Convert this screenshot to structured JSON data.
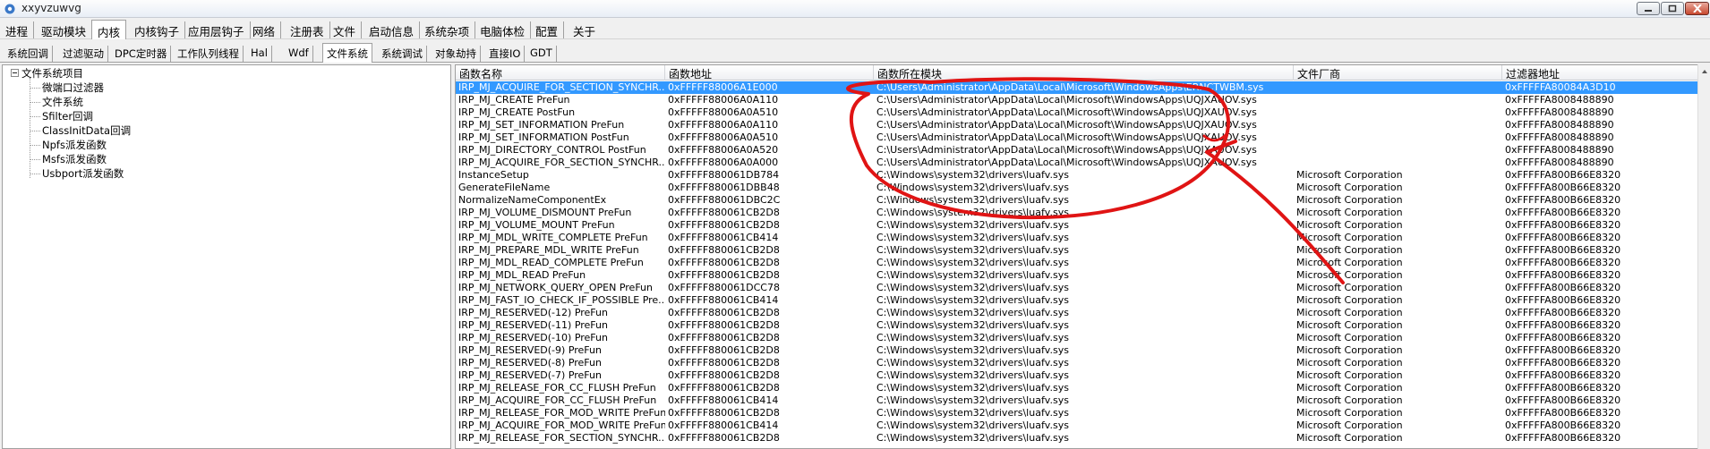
{
  "window": {
    "title": "xxyvzuwvg",
    "icon": "gear-app-icon",
    "controls": [
      "minimize-icon",
      "maximize-icon",
      "close-icon"
    ]
  },
  "menu": {
    "items": [
      "进程",
      "驱动模块",
      "内核",
      "内核钩子",
      "应用层钩子",
      "网络",
      "注册表",
      "文件",
      "启动信息",
      "系统杂项",
      "电脑体检",
      "配置",
      "关于"
    ],
    "active_index": 2
  },
  "subtabs": {
    "items": [
      "系统回调",
      "过滤驱动",
      "DPC定时器",
      "工作队列线程",
      "Hal",
      "Wdf",
      "文件系统",
      "系统调试",
      "对象劫持",
      "直接IO",
      "GDT"
    ],
    "active_index": 6
  },
  "tree": {
    "root": "文件系统项目",
    "children": [
      "微端口过滤器",
      "文件系统",
      "Sfilter回调",
      "ClassInitData回调",
      "Npfs派发函数",
      "Msfs派发函数",
      "Usbport派发函数"
    ]
  },
  "table": {
    "columns": [
      "函数名称",
      "函数地址",
      "函数所在模块",
      "文件厂商",
      "过滤器地址"
    ],
    "selected_row": 0,
    "rows": [
      [
        "IRP_MJ_ACQUIRE_FOR_SECTION_SYNCHR...",
        "0xFFFFF88006A1E000",
        "C:\\Users\\Administrator\\AppData\\Local\\Microsoft\\WindowsApps\\ERNCTWBM.sys",
        "",
        "0xFFFFFA80084A3D10"
      ],
      [
        "IRP_MJ_CREATE PreFun",
        "0xFFFFF88006A0A110",
        "C:\\Users\\Administrator\\AppData\\Local\\Microsoft\\WindowsApps\\UQJXAUOV.sys",
        "",
        "0xFFFFFA8008488890"
      ],
      [
        "IRP_MJ_CREATE PostFun",
        "0xFFFFF88006A0A510",
        "C:\\Users\\Administrator\\AppData\\Local\\Microsoft\\WindowsApps\\UQJXAUOV.sys",
        "",
        "0xFFFFFA8008488890"
      ],
      [
        "IRP_MJ_SET_INFORMATION PreFun",
        "0xFFFFF88006A0A110",
        "C:\\Users\\Administrator\\AppData\\Local\\Microsoft\\WindowsApps\\UQJXAUOV.sys",
        "",
        "0xFFFFFA8008488890"
      ],
      [
        "IRP_MJ_SET_INFORMATION PostFun",
        "0xFFFFF88006A0A510",
        "C:\\Users\\Administrator\\AppData\\Local\\Microsoft\\WindowsApps\\UQJXAUOV.sys",
        "",
        "0xFFFFFA8008488890"
      ],
      [
        "IRP_MJ_DIRECTORY_CONTROL PostFun",
        "0xFFFFF88006A0A520",
        "C:\\Users\\Administrator\\AppData\\Local\\Microsoft\\WindowsApps\\UQJXAUOV.sys",
        "",
        "0xFFFFFA8008488890"
      ],
      [
        "IRP_MJ_ACQUIRE_FOR_SECTION_SYNCHR...",
        "0xFFFFF88006A0A000",
        "C:\\Users\\Administrator\\AppData\\Local\\Microsoft\\WindowsApps\\UQJXAUOV.sys",
        "",
        "0xFFFFFA8008488890"
      ],
      [
        "InstanceSetup",
        "0xFFFFF880061DB784",
        "C:\\Windows\\system32\\drivers\\luafv.sys",
        "Microsoft Corporation",
        "0xFFFFFA800B66E8320"
      ],
      [
        "GenerateFileName",
        "0xFFFFF880061DBB48",
        "C:\\Windows\\system32\\drivers\\luafv.sys",
        "Microsoft Corporation",
        "0xFFFFFA800B66E8320"
      ],
      [
        "NormalizeNameComponentEx",
        "0xFFFFF880061DBC2C",
        "C:\\Windows\\system32\\drivers\\luafv.sys",
        "Microsoft Corporation",
        "0xFFFFFA800B66E8320"
      ],
      [
        "IRP_MJ_VOLUME_DISMOUNT PreFun",
        "0xFFFFF880061CB2D8",
        "C:\\Windows\\system32\\drivers\\luafv.sys",
        "Microsoft Corporation",
        "0xFFFFFA800B66E8320"
      ],
      [
        "IRP_MJ_VOLUME_MOUNT PreFun",
        "0xFFFFF880061CB2D8",
        "C:\\Windows\\system32\\drivers\\luafv.sys",
        "Microsoft Corporation",
        "0xFFFFFA800B66E8320"
      ],
      [
        "IRP_MJ_MDL_WRITE_COMPLETE PreFun",
        "0xFFFFF880061CB414",
        "C:\\Windows\\system32\\drivers\\luafv.sys",
        "Microsoft Corporation",
        "0xFFFFFA800B66E8320"
      ],
      [
        "IRP_MJ_PREPARE_MDL_WRITE PreFun",
        "0xFFFFF880061CB2D8",
        "C:\\Windows\\system32\\drivers\\luafv.sys",
        "Microsoft Corporation",
        "0xFFFFFA800B66E8320"
      ],
      [
        "IRP_MJ_MDL_READ_COMPLETE PreFun",
        "0xFFFFF880061CB2D8",
        "C:\\Windows\\system32\\drivers\\luafv.sys",
        "Microsoft Corporation",
        "0xFFFFFA800B66E8320"
      ],
      [
        "IRP_MJ_MDL_READ PreFun",
        "0xFFFFF880061CB2D8",
        "C:\\Windows\\system32\\drivers\\luafv.sys",
        "Microsoft Corporation",
        "0xFFFFFA800B66E8320"
      ],
      [
        "IRP_MJ_NETWORK_QUERY_OPEN PreFun",
        "0xFFFFF880061DCC78",
        "C:\\Windows\\system32\\drivers\\luafv.sys",
        "Microsoft Corporation",
        "0xFFFFFA800B66E8320"
      ],
      [
        "IRP_MJ_FAST_IO_CHECK_IF_POSSIBLE Pre...",
        "0xFFFFF880061CB414",
        "C:\\Windows\\system32\\drivers\\luafv.sys",
        "Microsoft Corporation",
        "0xFFFFFA800B66E8320"
      ],
      [
        "IRP_MJ_RESERVED(-12) PreFun",
        "0xFFFFF880061CB2D8",
        "C:\\Windows\\system32\\drivers\\luafv.sys",
        "Microsoft Corporation",
        "0xFFFFFA800B66E8320"
      ],
      [
        "IRP_MJ_RESERVED(-11) PreFun",
        "0xFFFFF880061CB2D8",
        "C:\\Windows\\system32\\drivers\\luafv.sys",
        "Microsoft Corporation",
        "0xFFFFFA800B66E8320"
      ],
      [
        "IRP_MJ_RESERVED(-10) PreFun",
        "0xFFFFF880061CB2D8",
        "C:\\Windows\\system32\\drivers\\luafv.sys",
        "Microsoft Corporation",
        "0xFFFFFA800B66E8320"
      ],
      [
        "IRP_MJ_RESERVED(-9) PreFun",
        "0xFFFFF880061CB2D8",
        "C:\\Windows\\system32\\drivers\\luafv.sys",
        "Microsoft Corporation",
        "0xFFFFFA800B66E8320"
      ],
      [
        "IRP_MJ_RESERVED(-8) PreFun",
        "0xFFFFF880061CB2D8",
        "C:\\Windows\\system32\\drivers\\luafv.sys",
        "Microsoft Corporation",
        "0xFFFFFA800B66E8320"
      ],
      [
        "IRP_MJ_RESERVED(-7) PreFun",
        "0xFFFFF880061CB2D8",
        "C:\\Windows\\system32\\drivers\\luafv.sys",
        "Microsoft Corporation",
        "0xFFFFFA800B66E8320"
      ],
      [
        "IRP_MJ_RELEASE_FOR_CC_FLUSH PreFun",
        "0xFFFFF880061CB2D8",
        "C:\\Windows\\system32\\drivers\\luafv.sys",
        "Microsoft Corporation",
        "0xFFFFFA800B66E8320"
      ],
      [
        "IRP_MJ_ACQUIRE_FOR_CC_FLUSH PreFun",
        "0xFFFFF880061CB414",
        "C:\\Windows\\system32\\drivers\\luafv.sys",
        "Microsoft Corporation",
        "0xFFFFFA800B66E8320"
      ],
      [
        "IRP_MJ_RELEASE_FOR_MOD_WRITE PreFun",
        "0xFFFFF880061CB2D8",
        "C:\\Windows\\system32\\drivers\\luafv.sys",
        "Microsoft Corporation",
        "0xFFFFFA800B66E8320"
      ],
      [
        "IRP_MJ_ACQUIRE_FOR_MOD_WRITE PreFun",
        "0xFFFFF880061CB414",
        "C:\\Windows\\system32\\drivers\\luafv.sys",
        "Microsoft Corporation",
        "0xFFFFFA800B66E8320"
      ],
      [
        "IRP_MJ_RELEASE_FOR_SECTION_SYNCHR...",
        "0xFFFFF880061CB2D8",
        "C:\\Windows\\system32\\drivers\\luafv.sys",
        "Microsoft Corporation",
        "0xFFFFFA800B66E8320"
      ]
    ]
  },
  "colors": {
    "selection": "#3399ff",
    "annotation": "#e01414"
  }
}
